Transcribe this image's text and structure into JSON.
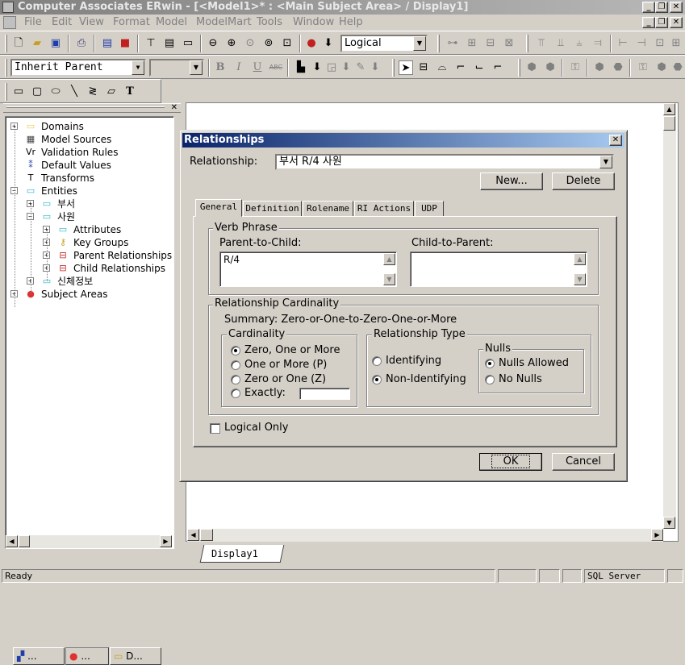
{
  "window": {
    "title": "Computer Associates ERwin - [<Model1>* : <Main Subject Area> / Display1]",
    "minimize": "_",
    "restore": "❐",
    "close": "✕"
  },
  "menu": {
    "items": [
      "File",
      "Edit",
      "View",
      "Format",
      "Model",
      "ModelMart",
      "Tools",
      "Window",
      "Help"
    ]
  },
  "toolbar": {
    "view_level": "Logical",
    "entity_display": "Inherit Parent",
    "font_size": "",
    "bold": "B",
    "italic": "I",
    "underline": "U",
    "strike": "ABC",
    "text_tool": "T"
  },
  "tree": {
    "items": [
      {
        "label": "Domains",
        "icon": "domains-icon",
        "glyph": "▭",
        "color": "#f2c94c",
        "expander": "+"
      },
      {
        "label": "Model Sources",
        "icon": "model-sources-icon",
        "glyph": "▦",
        "color": "#404040",
        "expander": ""
      },
      {
        "label": "Validation Rules",
        "icon": "validation-rules-icon",
        "glyph": "Vr",
        "color": "#000000",
        "expander": ""
      },
      {
        "label": "Default Values",
        "icon": "default-values-icon",
        "glyph": "⁑",
        "color": "#1f3ea8",
        "expander": ""
      },
      {
        "label": "Transforms",
        "icon": "transforms-icon",
        "glyph": "T",
        "color": "#000000",
        "expander": ""
      },
      {
        "label": "Entities",
        "icon": "entities-icon",
        "glyph": "▭",
        "color": "#2fb3c8",
        "expander": "−"
      },
      {
        "label": "부서",
        "icon": "entity-icon",
        "glyph": "▭",
        "color": "#2fb3c8",
        "expander": "+"
      },
      {
        "label": "사원",
        "icon": "entity-icon",
        "glyph": "▭",
        "color": "#2fb3c8",
        "expander": "−"
      },
      {
        "label": "Attributes",
        "icon": "attributes-icon",
        "glyph": "▭",
        "color": "#2fb3c8",
        "expander": "+"
      },
      {
        "label": "Key Groups",
        "icon": "key-groups-icon",
        "glyph": "⚷",
        "color": "#c8a020",
        "expander": "+"
      },
      {
        "label": "Parent Relationships",
        "icon": "parent-relationships-icon",
        "glyph": "⊟",
        "color": "#c02020",
        "expander": "+"
      },
      {
        "label": "Child Relationships",
        "icon": "child-relationships-icon",
        "glyph": "⊟",
        "color": "#c02020",
        "expander": "+"
      },
      {
        "label": "신체정보",
        "icon": "entity-icon",
        "glyph": "▭",
        "color": "#2fb3c8",
        "expander": "+"
      },
      {
        "label": "Subject Areas",
        "icon": "subject-areas-icon",
        "glyph": "●",
        "color": "#e03030",
        "expander": "+"
      }
    ]
  },
  "left_tabs": [
    "...",
    "...",
    "D..."
  ],
  "diagram_tab": "Display1",
  "dialog": {
    "title": "Relationships",
    "close": "✕",
    "relationship_label": "Relationship:",
    "relationship_value": "부서 R/4 사원",
    "new_button": "New...",
    "delete_button": "Delete",
    "tabs": [
      "General",
      "Definition",
      "Rolename",
      "RI Actions",
      "UDP"
    ],
    "verb_phrase": {
      "title": "Verb Phrase",
      "parent_to_child_label": "Parent-to-Child:",
      "parent_to_child_value": "R/4",
      "child_to_parent_label": "Child-to-Parent:",
      "child_to_parent_value": ""
    },
    "cardinality_group": {
      "title": "Relationship Cardinality",
      "summary": "Summary: Zero-or-One-to-Zero-One-or-More",
      "cardinality_title": "Cardinality",
      "options": [
        {
          "label": "Zero, One or More",
          "checked": true
        },
        {
          "label": "One or More (P)",
          "checked": false
        },
        {
          "label": "Zero or One (Z)",
          "checked": false
        },
        {
          "label": "Exactly:",
          "checked": false
        }
      ],
      "exactly_value": "",
      "type_title": "Relationship Type",
      "type_options": [
        {
          "label": "Identifying",
          "checked": false
        },
        {
          "label": "Non-Identifying",
          "checked": true
        }
      ],
      "nulls_title": "Nulls",
      "nulls_options": [
        {
          "label": "Nulls Allowed",
          "checked": true
        },
        {
          "label": "No Nulls",
          "checked": false
        }
      ]
    },
    "logical_only_label": "Logical Only",
    "logical_only_checked": false,
    "ok_button": "OK",
    "cancel_button": "Cancel"
  },
  "status": {
    "text": "Ready",
    "db": "SQL Server"
  }
}
